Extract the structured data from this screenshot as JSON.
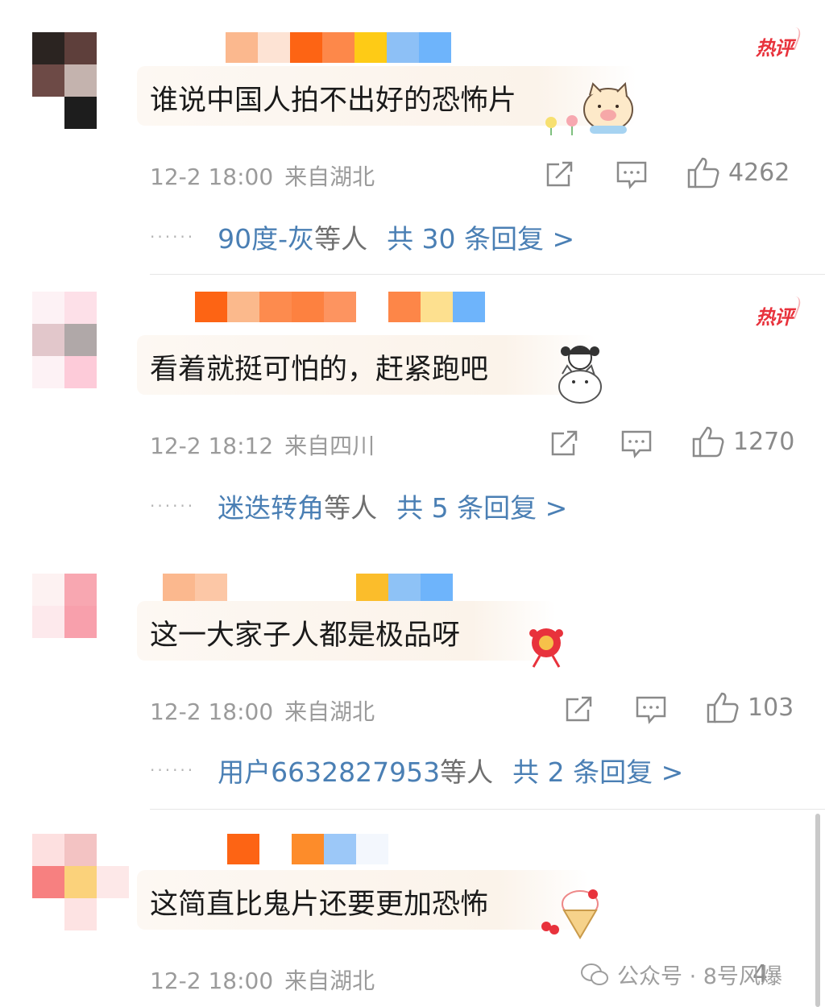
{
  "comments": [
    {
      "hot_label": "热评",
      "text": "谁说中国人拍不出好的恐怖片",
      "time": "12-2 18:00",
      "location": "来自湖北",
      "like_count": "4262",
      "reply_user": "90度-灰",
      "reply_mid": "等人",
      "reply_total": "共 30 条回复 >",
      "avatar_colors": [
        "#2b2421",
        "#5e3f3b",
        "#ffffff",
        "#6d4a46",
        "#c4b3ae",
        "#ffffff",
        "#ffffff",
        "#1d1d1d",
        "#ffffff"
      ],
      "name_colors": [
        "#fbb88e",
        "#fde3d4",
        "#fd6414",
        "#fd884a",
        "#fecb16",
        "#8dc0f6",
        "#6eb4fb"
      ]
    },
    {
      "hot_label": "热评",
      "text": "看着就挺可怕的，赶紧跑吧",
      "time": "12-2 18:12",
      "location": "来自四川",
      "like_count": "1270",
      "reply_user": "迷迭转角",
      "reply_mid": "等人",
      "reply_total": "共 5 条回复 >",
      "avatar_colors": [
        "#fdf2f5",
        "#fde0e8",
        "#ffffff",
        "#e2c7cb",
        "#b0a8a8",
        "#ffffff",
        "#fdf2f5",
        "#fdcbd9",
        "#ffffff"
      ],
      "name_colors": [
        "#fd6414",
        "#fbb98c",
        "#fd8b4e",
        "#fd8140",
        "#fd9460",
        "#ffffff",
        "#fd8648",
        "#fde08f",
        "#6eb4fb"
      ]
    },
    {
      "hot_label": "",
      "text": "这一大家子人都是极品呀",
      "time": "12-2 18:00",
      "location": "来自湖北",
      "like_count": "103",
      "reply_user": "用户6632827953",
      "reply_mid": "等人",
      "reply_total": "共 2 条回复 >",
      "avatar_colors": [
        "#fdf2f2",
        "#f8a7b1",
        "#ffffff",
        "#fde9ec",
        "#f8a0ac",
        "#ffffff",
        "#ffffff",
        "#ffffff",
        "#ffffff"
      ],
      "name_colors": [
        "#fbb88e",
        "#fcc7a6",
        "#ffffff",
        "#ffffff",
        "#ffffff",
        "#ffffff",
        "#fbbd2b",
        "#8ec2f6",
        "#6eb4fb"
      ]
    },
    {
      "hot_label": "",
      "text": "这简直比鬼片还要更加恐怖",
      "time": "12-2 18:00",
      "location": "来自湖北",
      "like_count": "4",
      "reply_user": "",
      "reply_mid": "",
      "reply_total": "",
      "avatar_colors": [
        "#fde0e0",
        "#f3c3c3",
        "#ffffff",
        "#f78080",
        "#fbd27b",
        "#fde8e8",
        "#ffffff",
        "#fde3e3",
        "#ffffff"
      ],
      "name_colors": [
        "#fd6414",
        "#ffffff",
        "#fd8c2a",
        "#9cc8f8",
        "#f3f7fd"
      ]
    }
  ],
  "watermark": {
    "text": "公众号 · 8号风爆",
    "icon": "wechat-icon"
  },
  "icons": {
    "share": "share-icon",
    "comment": "comment-icon",
    "like": "thumbs-up-icon"
  },
  "colors": {
    "link": "#4a7fb4",
    "hot": "#e8323c",
    "meta": "#9b9b9b"
  }
}
